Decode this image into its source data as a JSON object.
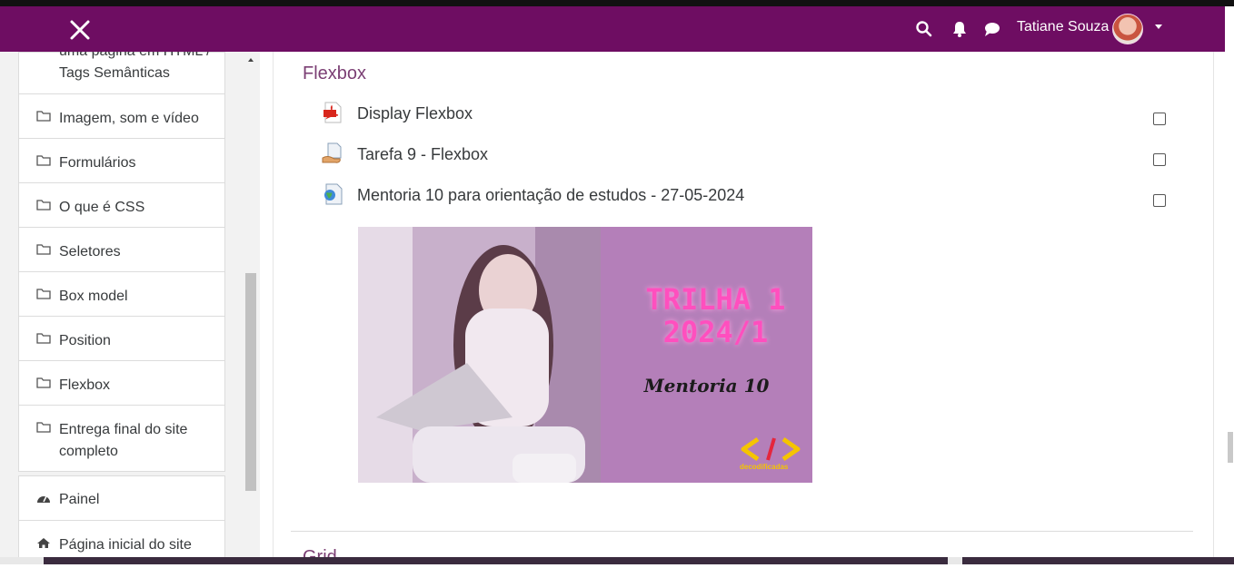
{
  "navbar": {
    "user_name": "Tatiane Souza",
    "icons": [
      "close-icon",
      "search-icon",
      "bell-icon",
      "chat-icon",
      "chevron-down-icon"
    ],
    "colors": {
      "navbar_bg": "#6e0d62",
      "section_title": "#7b3f74"
    }
  },
  "sidebar": {
    "items": [
      {
        "label": "uma página em HTML / Tags Semânticas",
        "icon": "folder-icon"
      },
      {
        "label": "Imagem, som e vídeo",
        "icon": "folder-icon"
      },
      {
        "label": "Formulários",
        "icon": "folder-icon"
      },
      {
        "label": "O que é CSS",
        "icon": "folder-icon"
      },
      {
        "label": "Seletores",
        "icon": "folder-icon"
      },
      {
        "label": "Box model",
        "icon": "folder-icon"
      },
      {
        "label": "Position",
        "icon": "folder-icon"
      },
      {
        "label": "Flexbox",
        "icon": "folder-icon"
      },
      {
        "label": "Entrega final do site completo",
        "icon": "folder-icon"
      }
    ],
    "nav": [
      {
        "label": "Painel",
        "icon": "dashboard-icon"
      },
      {
        "label": "Página inicial do site",
        "icon": "home-icon"
      }
    ]
  },
  "main": {
    "section_title": "Flexbox",
    "activities": [
      {
        "label": "Display Flexbox",
        "icon": "pdf-file-icon"
      },
      {
        "label": "Tarefa 9 - Flexbox",
        "icon": "assignment-icon"
      },
      {
        "label": "Mentoria 10 para orientação de estudos - 27-05-2024",
        "icon": "url-globe-icon"
      }
    ],
    "banner": {
      "line1": "TRILHA 1",
      "line2": "2024/1",
      "subtitle": "Mentoria 10",
      "logo_text": "decodificadas"
    },
    "next_section_title": "Grid"
  }
}
